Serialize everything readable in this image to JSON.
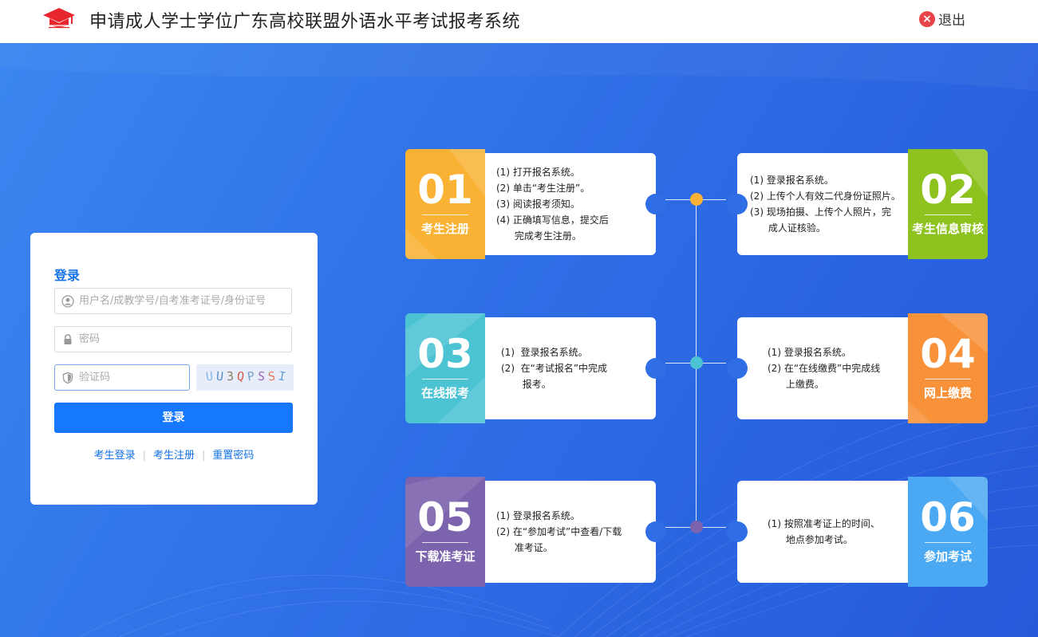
{
  "header": {
    "title": "申请成人学士学位广东高校联盟外语水平考试报考系统",
    "logout_label": "退出",
    "logout_icon": "close-circle-icon",
    "logo_icon": "graduation-cap-icon"
  },
  "login": {
    "title": "登录",
    "username_placeholder": "用户名/成教学号/自考准考证号/身份证号",
    "password_placeholder": "密码",
    "captcha_placeholder": "验证码",
    "captcha_text": [
      "U",
      "U",
      "3",
      "Q",
      "P",
      "S",
      "S",
      "I"
    ],
    "submit_label": "登录",
    "links": [
      "考生登录",
      "考生注册",
      "重置密码"
    ]
  },
  "colors": {
    "accent": "#1677ff",
    "step1": "#f9b233",
    "step2": "#8dc21f",
    "step3": "#4cc3d3",
    "step4": "#f8923a",
    "step5": "#7b63ad",
    "step6": "#4aa9f2"
  },
  "steps": [
    {
      "num": "01",
      "label": "考生注册",
      "lines": [
        "(1) 打开报名系统。",
        "(2) 单击“考生注册”。",
        "(3) 阅读报考须知。",
        "(4) 正确填写信息，提交后",
        "      完成考生注册。"
      ]
    },
    {
      "num": "02",
      "label": "考生信息审核",
      "lines": [
        "(1) 登录报名系统。",
        "(2) 上传个人有效二代身份证照片。",
        "(3) 现场拍摄、上传个人照片，完",
        "      成人证核验。"
      ]
    },
    {
      "num": "03",
      "label": "在线报考",
      "lines": [
        "(1)  登录报名系统。",
        "(2)  在“考试报名”中完成",
        "       报考。"
      ]
    },
    {
      "num": "04",
      "label": "网上缴费",
      "lines": [
        "(1) 登录报名系统。",
        "(2) 在“在线缴费”中完成线",
        "      上缴费。"
      ]
    },
    {
      "num": "05",
      "label": "下载准考证",
      "lines": [
        "(1) 登录报名系统。",
        "(2) 在“参加考试”中查看/下载",
        "      准考证。"
      ]
    },
    {
      "num": "06",
      "label": "参加考试",
      "lines": [
        "(1) 按照准考证上的时间、",
        "      地点参加考试。"
      ]
    }
  ]
}
